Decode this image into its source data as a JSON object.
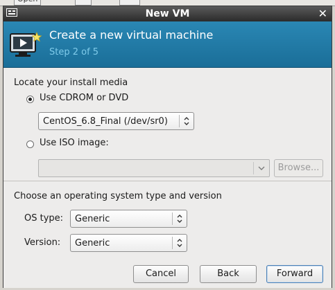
{
  "dialog": {
    "title": "New VM"
  },
  "banner": {
    "title": "Create a new virtual machine",
    "step": "Step 2 of 5"
  },
  "install_media": {
    "section_label": "Locate your install media",
    "cdrom_option": {
      "label": "Use CDROM or DVD",
      "selected": true
    },
    "cdrom_device": "CentOS_6.8_Final (/dev/sr0)",
    "iso_option": {
      "label": "Use ISO image:",
      "selected": false
    },
    "iso_path": "",
    "browse_label": "Browse..."
  },
  "os": {
    "section_label": "Choose an operating system type and version",
    "type_label": "OS type:",
    "type_value": "Generic",
    "version_label": "Version:",
    "version_value": "Generic"
  },
  "buttons": {
    "cancel": "Cancel",
    "back": "Back",
    "forward": "Forward"
  },
  "background_window": {
    "open_label": "Open"
  },
  "colors": {
    "banner": "#1a6e98",
    "banner_step_text": "#7fcbea",
    "titlebar": "#2b2b2b"
  }
}
